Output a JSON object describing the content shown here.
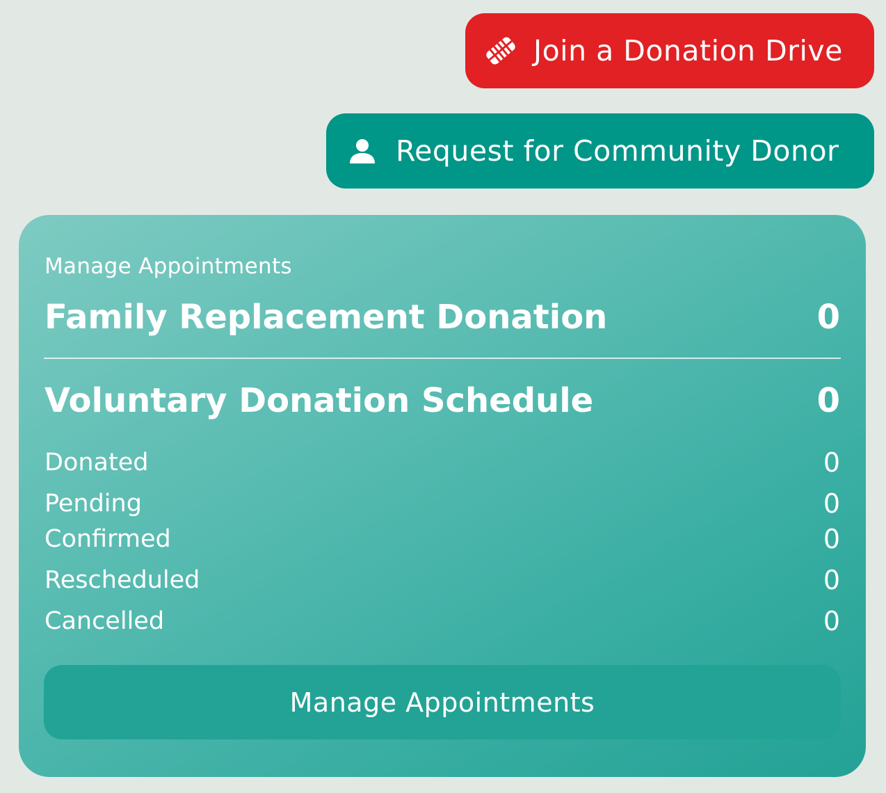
{
  "actions": {
    "join_drive": {
      "label": "Join a Donation Drive",
      "icon": "handshake-icon",
      "color": "#e12124"
    },
    "request_donor": {
      "label": "Request for Community Donor",
      "icon": "person-icon",
      "color": "#009688"
    }
  },
  "card": {
    "subtitle": "Manage Appointments",
    "family": {
      "label": "Family Replacement Donation",
      "count": "0"
    },
    "voluntary": {
      "label": "Voluntary Donation Schedule",
      "count": "0"
    },
    "statuses": [
      {
        "label": "Donated",
        "count": "0"
      },
      {
        "label": "Pending",
        "count": "0"
      },
      {
        "label": "Confirmed",
        "count": "0"
      },
      {
        "label": "Rescheduled",
        "count": "0"
      },
      {
        "label": "Cancelled",
        "count": "0"
      }
    ],
    "button_label": "Manage Appointments"
  }
}
